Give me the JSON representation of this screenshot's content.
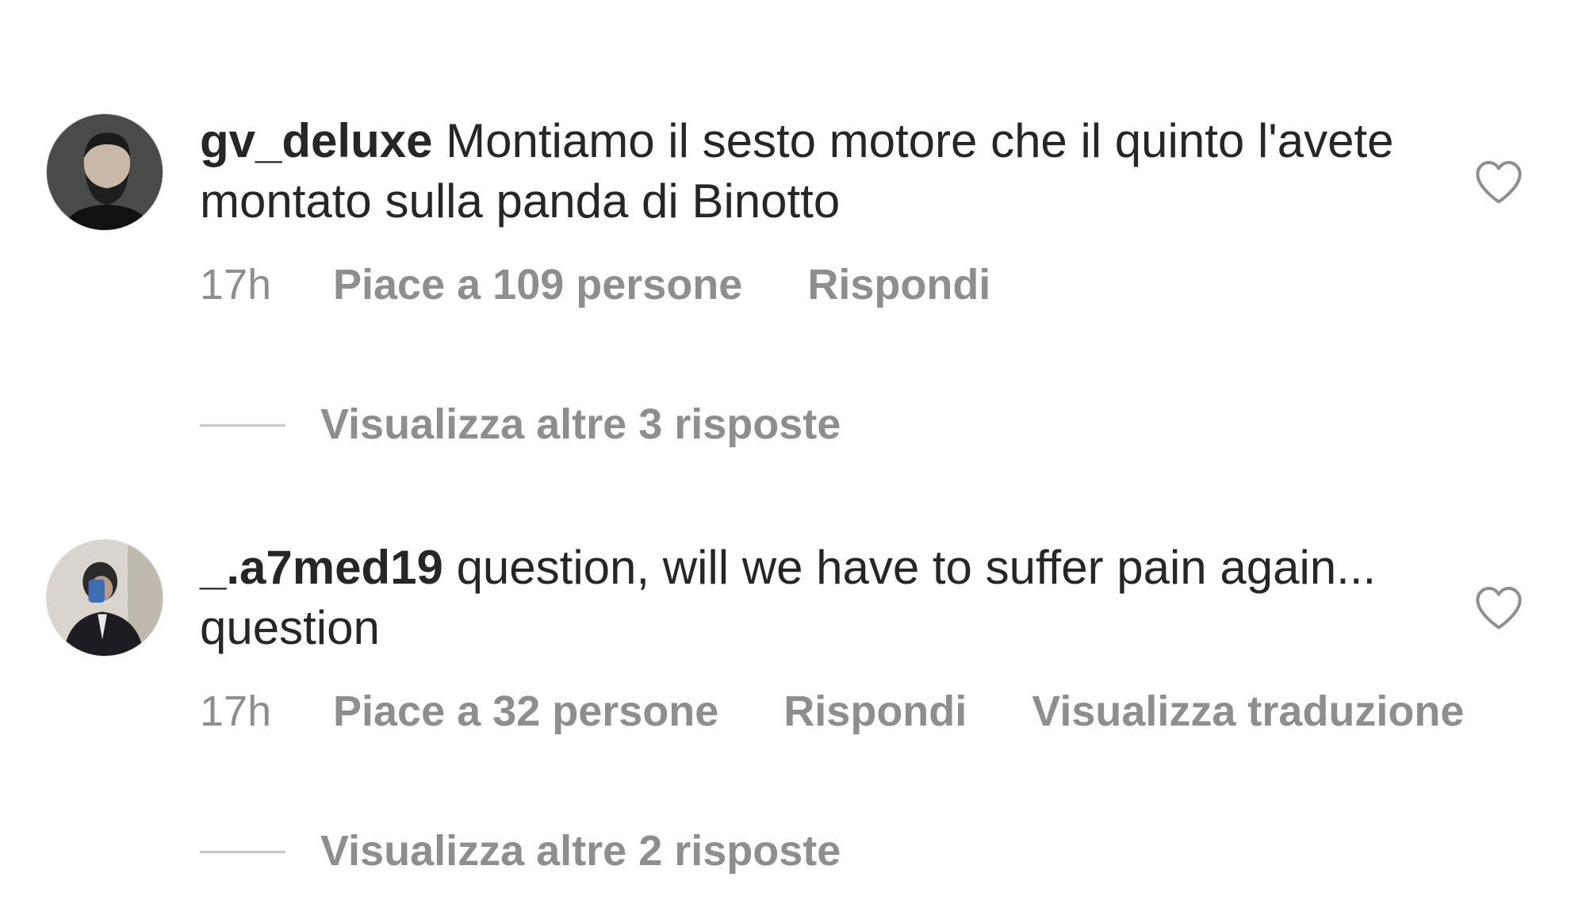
{
  "comments": [
    {
      "username": "gv_deluxe",
      "text": "Montiamo il sesto motore che il quinto l'avete montato sulla panda di Binotto",
      "time": "17h",
      "likes": "Piace a 109 persone",
      "reply": "Rispondi",
      "view_replies": "Visualizza altre 3 risposte"
    },
    {
      "username": "_.a7med19",
      "text": "question, will we have to suffer pain again... question",
      "time": "17h",
      "likes": "Piace a 32 persone",
      "reply": "Rispondi",
      "translate": "Visualizza traduzione",
      "view_replies": "Visualizza altre 2 risposte"
    }
  ],
  "icons": {
    "like": "heart-outline-icon"
  },
  "colors": {
    "text": "#262626",
    "secondary": "#8e8e8e",
    "divider": "#c7c7c7"
  }
}
